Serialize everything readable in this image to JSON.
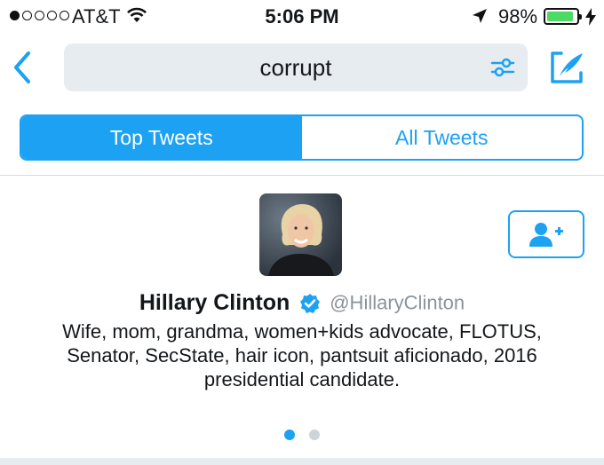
{
  "status_bar": {
    "carrier": "AT&T",
    "time": "5:06 PM",
    "battery_percent": "98%",
    "signal_bars_filled": 1,
    "signal_bars_total": 5,
    "battery_level": 0.98,
    "battery_color": "#4cd964"
  },
  "search": {
    "query": "corrupt"
  },
  "tabs": [
    {
      "label": "Top Tweets",
      "active": true
    },
    {
      "label": "All Tweets",
      "active": false
    }
  ],
  "profile": {
    "name": "Hillary Clinton",
    "handle": "@HillaryClinton",
    "verified": true,
    "bio_lines": [
      "Wife, mom, grandma, women+kids advocate, FLOTUS,",
      "Senator, SecState, hair icon, pantsuit aficionado, 2016",
      "presidential candidate."
    ]
  },
  "pager": {
    "count": 2,
    "active_index": 0
  },
  "colors": {
    "accent": "#1da1f2",
    "text": "#14171a",
    "muted": "#8a939b"
  },
  "icons": [
    "back-chevron-icon",
    "wifi-icon",
    "location-arrow-icon",
    "battery-icon",
    "charging-bolt-icon",
    "filter-icon",
    "compose-icon",
    "add-user-icon",
    "verified-badge-icon"
  ]
}
